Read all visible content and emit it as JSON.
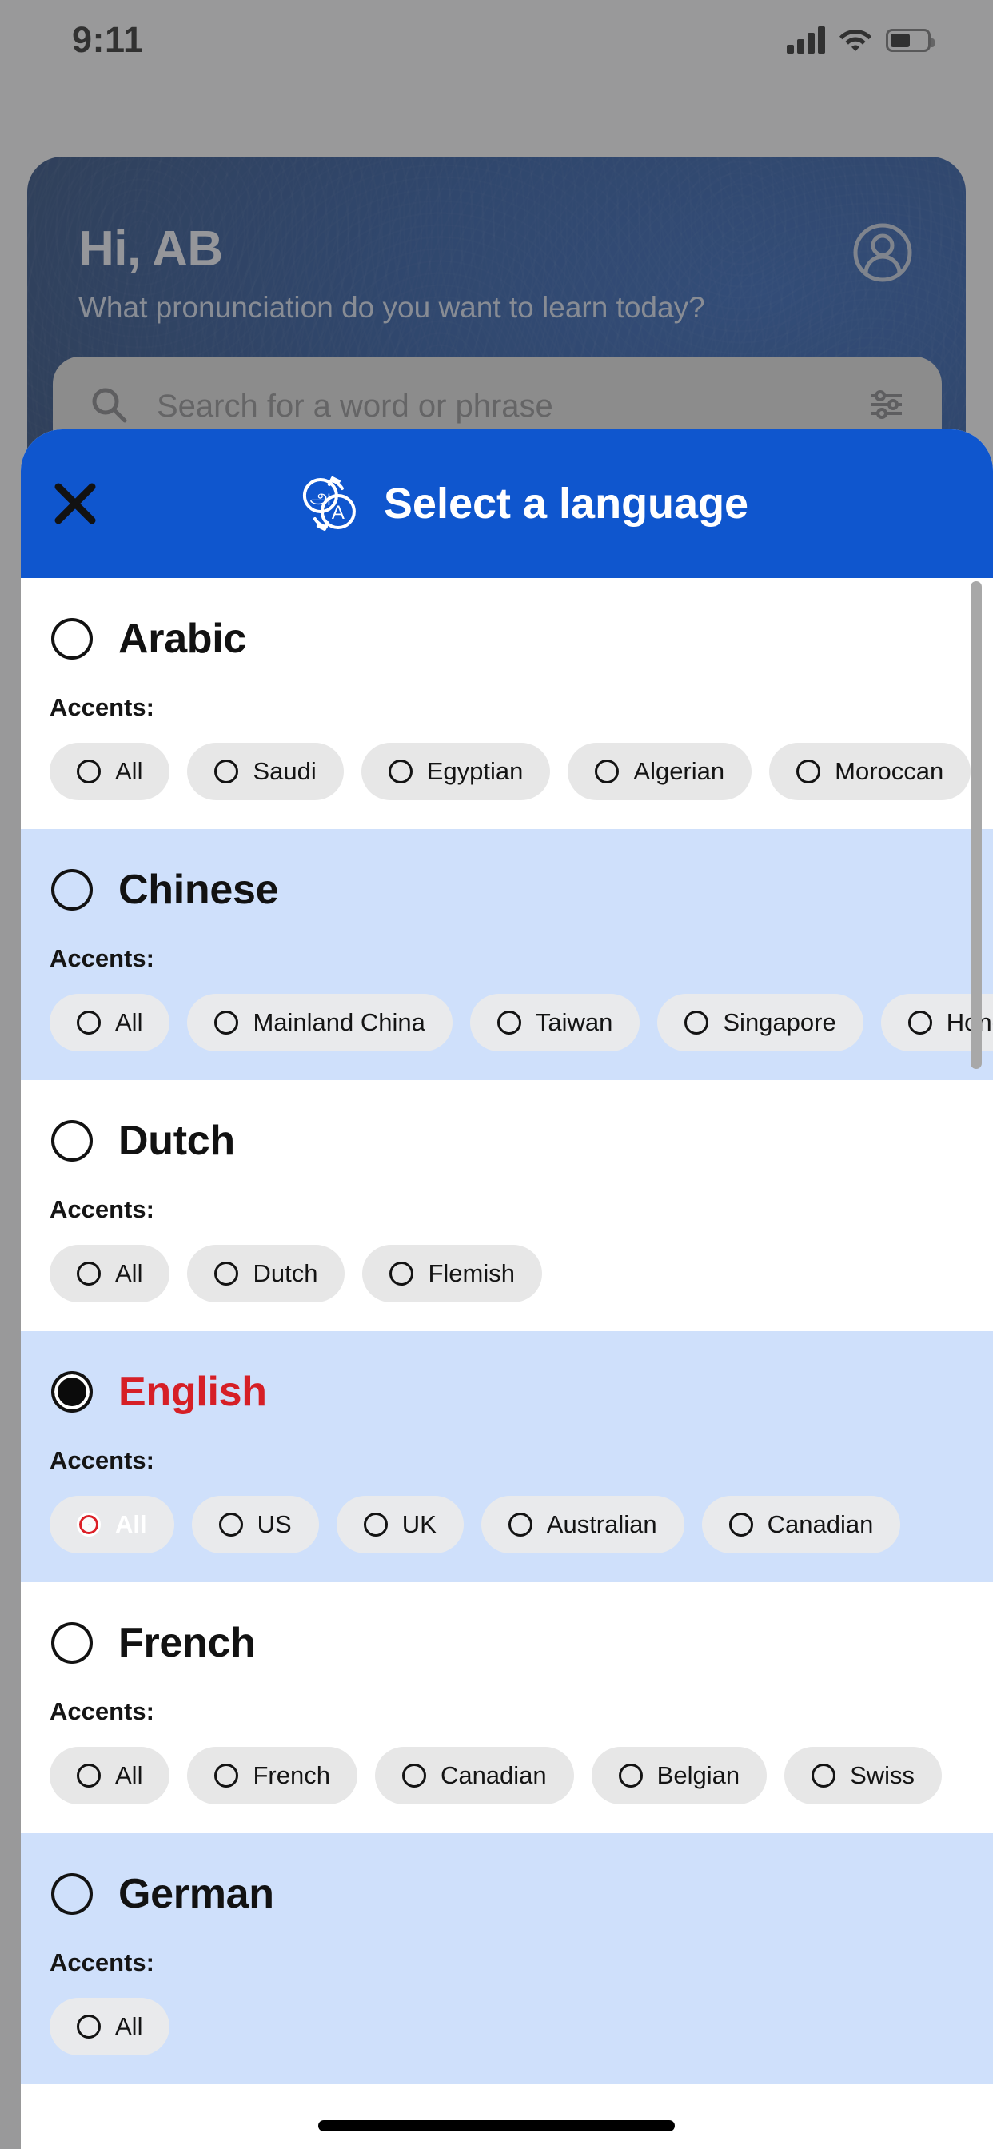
{
  "status_bar": {
    "time": "9:11",
    "signal_icon": "cellular-signal-icon",
    "wifi_icon": "wifi-icon",
    "battery_icon": "battery-icon"
  },
  "background_app": {
    "greeting": "Hi, AB",
    "subtitle": "What pronunciation do you want to learn today?",
    "avatar_icon": "account-circle-icon",
    "search": {
      "placeholder": "Search for a word or phrase",
      "search_icon": "search-icon",
      "filter_icon": "filter-sliders-icon"
    }
  },
  "modal": {
    "title": "Select a language",
    "close_icon": "close-icon",
    "translate_icon": "translate-icon",
    "accent_label": "Accents:",
    "header_bg": "#0f56ce",
    "selected_color": "#d61f26",
    "alt_row_bg": "#cfe0fb",
    "languages": [
      {
        "name": "Arabic",
        "selected": false,
        "accents": [
          {
            "label": "All",
            "selected": false
          },
          {
            "label": "Saudi",
            "selected": false
          },
          {
            "label": "Egyptian",
            "selected": false
          },
          {
            "label": "Algerian",
            "selected": false
          },
          {
            "label": "Moroccan",
            "selected": false
          }
        ]
      },
      {
        "name": "Chinese",
        "selected": false,
        "accents": [
          {
            "label": "All",
            "selected": false
          },
          {
            "label": "Mainland China",
            "selected": false
          },
          {
            "label": "Taiwan",
            "selected": false
          },
          {
            "label": "Singapore",
            "selected": false
          },
          {
            "label": "Hong Kong",
            "selected": false
          }
        ]
      },
      {
        "name": "Dutch",
        "selected": false,
        "accents": [
          {
            "label": "All",
            "selected": false
          },
          {
            "label": "Dutch",
            "selected": false
          },
          {
            "label": "Flemish",
            "selected": false
          }
        ]
      },
      {
        "name": "English",
        "selected": true,
        "accents": [
          {
            "label": "All",
            "selected": true
          },
          {
            "label": "US",
            "selected": false
          },
          {
            "label": "UK",
            "selected": false
          },
          {
            "label": "Australian",
            "selected": false
          },
          {
            "label": "Canadian",
            "selected": false
          }
        ]
      },
      {
        "name": "French",
        "selected": false,
        "accents": [
          {
            "label": "All",
            "selected": false
          },
          {
            "label": "French",
            "selected": false
          },
          {
            "label": "Canadian",
            "selected": false
          },
          {
            "label": "Belgian",
            "selected": false
          },
          {
            "label": "Swiss",
            "selected": false
          }
        ]
      },
      {
        "name": "German",
        "selected": false,
        "accents": [
          {
            "label": "All",
            "selected": false
          }
        ]
      }
    ]
  }
}
